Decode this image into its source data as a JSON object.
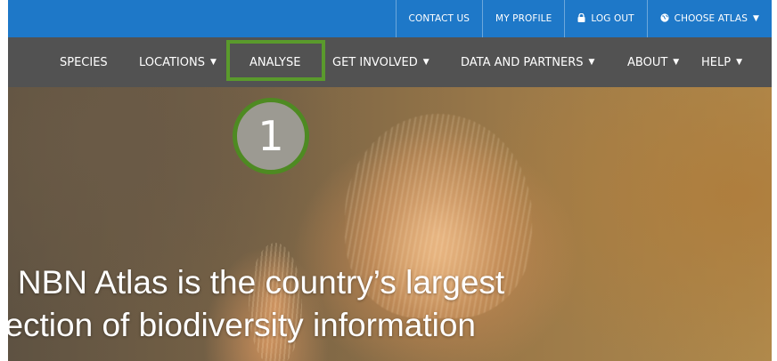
{
  "topbar": {
    "links": [
      {
        "label": "CONTACT US",
        "icon": ""
      },
      {
        "label": "MY PROFILE",
        "icon": ""
      },
      {
        "label": "LOG OUT",
        "icon": "lock-icon"
      },
      {
        "label": "CHOOSE ATLAS",
        "icon": "globe-icon",
        "caret": "caret-down-icon"
      }
    ]
  },
  "nav": {
    "items": [
      {
        "label": "SPECIES"
      },
      {
        "label": "LOCATIONS"
      },
      {
        "label": "ANALYSE"
      },
      {
        "label": "GET INVOLVED"
      },
      {
        "label": "DATA AND PARTNERS"
      },
      {
        "label": "ABOUT"
      },
      {
        "label": "HELP"
      }
    ]
  },
  "annotation": {
    "step_number": "1",
    "highlight_color": "#5a9a2c"
  },
  "hero": {
    "line1": "e NBN Atlas is the country’s largest",
    "line2": "llection of biodiversity information"
  },
  "colors": {
    "topbar": "#1e78c8",
    "navbar": "#525252"
  }
}
